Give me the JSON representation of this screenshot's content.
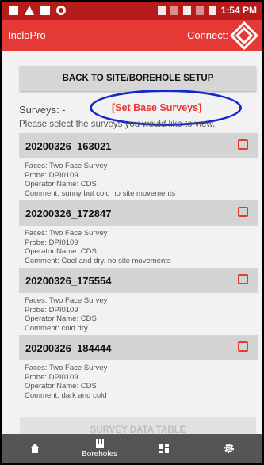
{
  "status_bar": {
    "time": "1:54 PM"
  },
  "app_bar": {
    "title": "IncloPro",
    "connect_label": "Connect:"
  },
  "back_button_label": "BACK TO SITE/BOREHOLE SETUP",
  "surveys_label": "Surveys: -",
  "set_base_label": "[Set Base Surveys]",
  "instruction": "Please select the surveys you would like to view.",
  "surveys": [
    {
      "name": "20200326_163021",
      "faces": "Faces: Two Face Survey",
      "probe": "Probe: DPI0109",
      "operator": "Operator Name: CDS",
      "comment": "Comment: sunny but cold no site movements"
    },
    {
      "name": "20200326_172847",
      "faces": "Faces: Two Face Survey",
      "probe": "Probe: DPI0109",
      "operator": "Operator Name: CDS",
      "comment": "Comment: Cool and dry.  no site movements"
    },
    {
      "name": "20200326_175554",
      "faces": "Faces: Two Face Survey",
      "probe": "Probe: DPI0109",
      "operator": "Operator Name: CDS",
      "comment": "Comment: cold dry"
    },
    {
      "name": "20200326_184444",
      "faces": "Faces: Two Face Survey",
      "probe": "Probe: DPI0109",
      "operator": "Operator Name: CDS",
      "comment": "Comment: dark and cold"
    }
  ],
  "data_table_label": "SURVEY DATA TABLE",
  "bottom_nav": {
    "home_icon": "home-icon",
    "boreholes_label": "Boreholes",
    "dashboard_icon": "grid-icon",
    "settings_icon": "gear-icon"
  },
  "colors": {
    "status_bar": "#b71c1c",
    "app_bar": "#e53935",
    "accent": "#e53935",
    "annotation": "#1427c9",
    "nav": "#555555"
  }
}
